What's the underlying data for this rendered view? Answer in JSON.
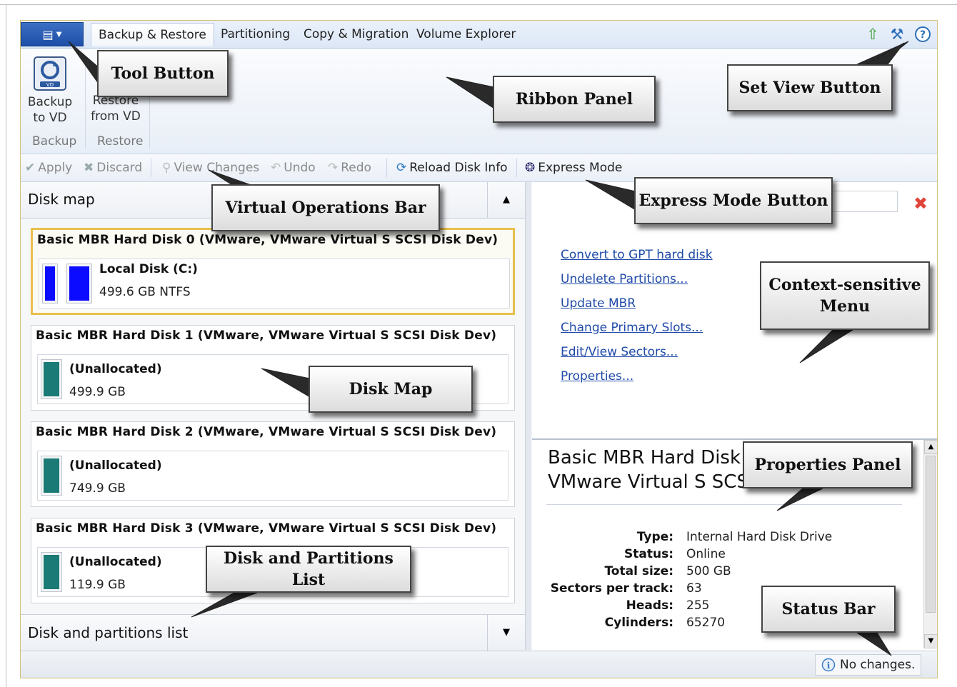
{
  "tabs": [
    {
      "label": "Backup & Restore",
      "active": true
    },
    {
      "label": "Partitioning",
      "active": false
    },
    {
      "label": "Copy & Migration",
      "active": false
    },
    {
      "label": "Volume Explorer",
      "active": false
    }
  ],
  "top_icons": [
    "home-up-arrow-icon",
    "tools-icon",
    "help-icon"
  ],
  "ribbon": {
    "backup_btn": "Backup\nto VD",
    "restore_btn": "Restore\nfrom VD",
    "group_backup": "Backup",
    "group_restore": "Restore"
  },
  "ops": {
    "apply": "Apply",
    "discard": "Discard",
    "view_changes": "View Changes",
    "undo": "Undo",
    "redo": "Redo",
    "reload": "Reload Disk Info",
    "express": "Express Mode"
  },
  "disk_map": {
    "title": "Disk map",
    "disks": [
      {
        "title": "Basic MBR Hard Disk 0 (VMware, VMware Virtual S SCSI Disk Dev)",
        "part_label": "Local Disk (C:)",
        "part_size": "499.6 GB NTFS",
        "color": "#0b0bff",
        "selected": true
      },
      {
        "title": "Basic MBR Hard Disk 1 (VMware, VMware Virtual S SCSI Disk Dev)",
        "part_label": "(Unallocated)",
        "part_size": "499.9 GB",
        "color": "#1a7a76",
        "selected": false
      },
      {
        "title": "Basic MBR Hard Disk 2 (VMware, VMware Virtual S SCSI Disk Dev)",
        "part_label": "(Unallocated)",
        "part_size": "749.9 GB",
        "color": "#1a7a76",
        "selected": false
      },
      {
        "title": "Basic MBR Hard Disk 3 (VMware, VMware Virtual S SCSI Disk Dev)",
        "part_label": "(Unallocated)",
        "part_size": "119.9 GB",
        "color": "#1a7a76",
        "selected": false
      }
    ]
  },
  "disk_list": {
    "title": "Disk and partitions list"
  },
  "context_menu": [
    "Convert to GPT hard disk",
    "Undelete Partitions...",
    "Update MBR",
    "Change Primary Slots...",
    "Edit/View Sectors...",
    "Properties..."
  ],
  "properties": {
    "title_line1": "Basic MBR Hard Disk",
    "title_line2": "VMware Virtual S SCS",
    "rows": [
      {
        "key": "Type:",
        "value": "Internal Hard Disk Drive"
      },
      {
        "key": "Status:",
        "value": "Online"
      },
      {
        "key": "Total size:",
        "value": "500 GB"
      },
      {
        "key": "Sectors per track:",
        "value": "63"
      },
      {
        "key": "Heads:",
        "value": "255"
      },
      {
        "key": "Cylinders:",
        "value": "65270"
      }
    ]
  },
  "status": {
    "text": "No changes."
  },
  "callouts": {
    "tool_button": "Tool Button",
    "ribbon_panel": "Ribbon Panel",
    "set_view_button": "Set View Button",
    "virtual_ops_bar": "Virtual Operations Bar",
    "express_mode_button": "Express Mode Button",
    "context_menu_line1": "Context-sensitive",
    "context_menu_line2": "Menu",
    "disk_map": "Disk Map",
    "properties_panel": "Properties Panel",
    "disk_partitions_list": "Disk and Partitions List",
    "status_bar": "Status Bar"
  }
}
